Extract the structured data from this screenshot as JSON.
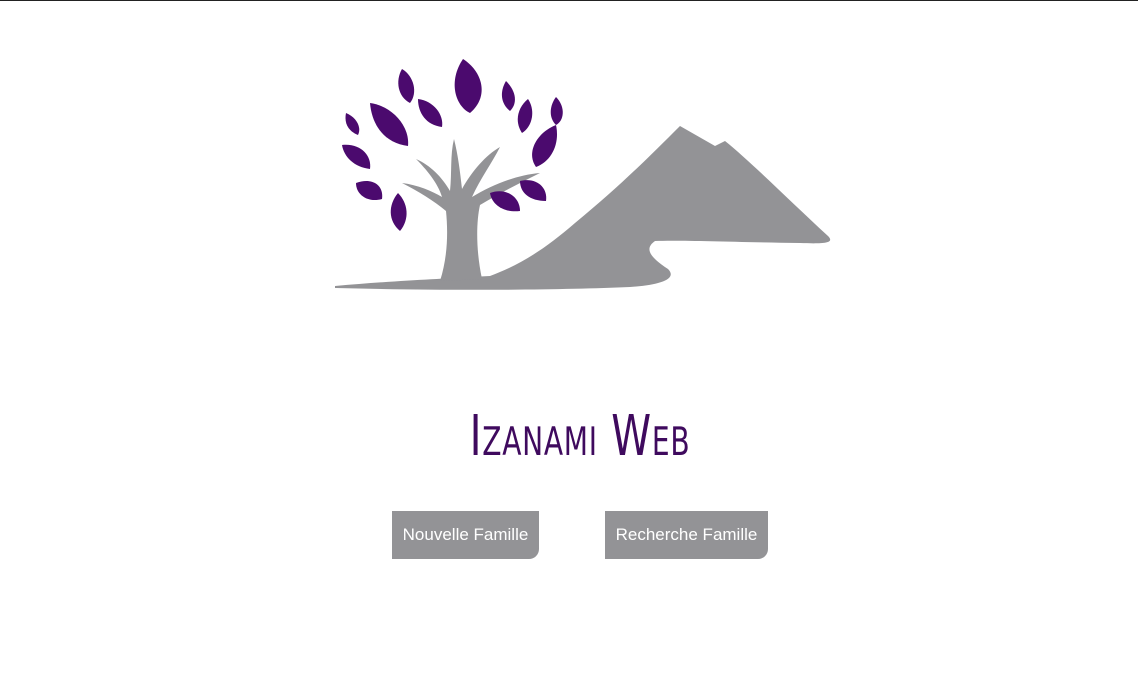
{
  "app": {
    "title": "Izanami Web"
  },
  "logo": {
    "icon": "tree-mountain-logo-icon",
    "leaf_color": "#4b0a6e",
    "trunk_color": "#939396"
  },
  "actions": {
    "new_family_label": "Nouvelle Famille",
    "search_family_label": "Recherche Famille"
  },
  "colors": {
    "title": "#3f0a5e",
    "button_bg": "#939396",
    "button_text": "#ffffff"
  }
}
